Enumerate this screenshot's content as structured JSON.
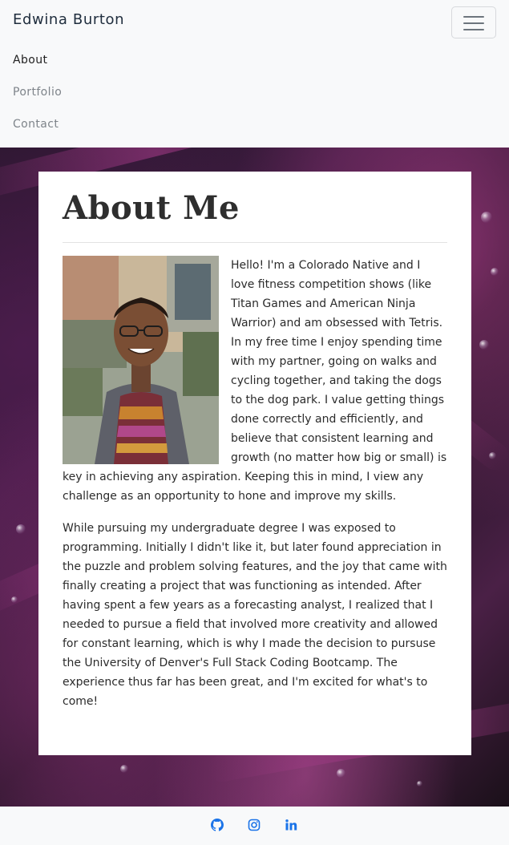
{
  "navbar": {
    "brand": "Edwina Burton",
    "toggler_icon": "hamburger-icon",
    "links": [
      {
        "label": "About",
        "active": true
      },
      {
        "label": "Portfolio",
        "active": false
      },
      {
        "label": "Contact",
        "active": false
      }
    ]
  },
  "about": {
    "heading": "About Me",
    "photo_alt": "Photo of Edwina Burton",
    "paragraphs": [
      "Hello! I'm a Colorado Native and I love fitness competition shows (like Titan Games and American Ninja Warrior) and am obsessed with Tetris. In my free time I enjoy spending time with my partner, going on walks and cycling together, and taking the dogs to the dog park. I value getting things done correctly and efficiently, and believe that consistent learning and growth (no matter how big or small) is key in achieving any aspiration. Keeping this in mind, I view any challenge as an opportunity to hone and improve my skills.",
      "While pursuing my undergraduate degree I was exposed to programming. Initially I didn't like it, but later found appreciation in the puzzle and problem solving features, and the joy that came with finally creating a project that was functioning as intended. After having spent a few years as a forecasting analyst, I realized that I needed to pursue a field that involved more creativity and allowed for constant learning, which is why I made the decision to pursuse the University of Denver's Full Stack Coding Bootcamp. The experience thus far has been great, and I'm excited for what's to come!"
    ]
  },
  "footer": {
    "icons": [
      "github-icon",
      "instagram-icon",
      "linkedin-icon"
    ]
  },
  "colors": {
    "accent": "#1a73e8",
    "navbar_bg": "#f8f9fa",
    "hero_purple": "#4a2046"
  }
}
